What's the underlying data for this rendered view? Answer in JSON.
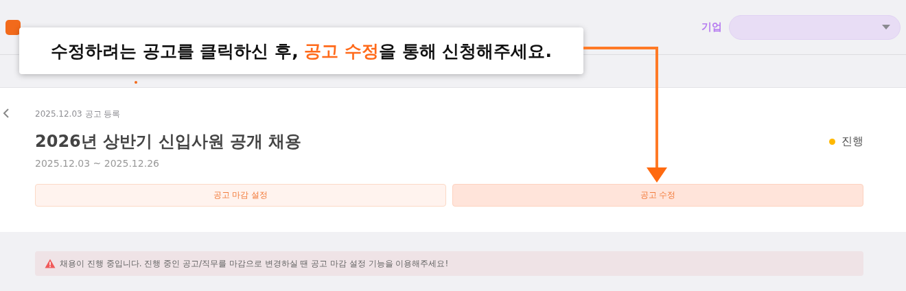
{
  "header": {
    "company_label": "기업"
  },
  "guide": {
    "text": "수정하려는 공고를 클릭하신 후, **공고 수정**을 통해 신청해주세요."
  },
  "posting": {
    "registered": "2025.12.03 공고 등록",
    "title": "2026년 상반기 신입사원 공개 채용",
    "period": "2025.12.03 ~ 2025.12.26",
    "status": {
      "label": "진행",
      "color": "#ffb800"
    },
    "buttons": [
      {
        "label": "공고 마감 설정",
        "selected": false
      },
      {
        "label": "공고 수정",
        "selected": true
      }
    ]
  },
  "alert": {
    "text": "채용이 진행 중입니다. 진행 중인 공고/직무를 마감으로 변경하실 땐 공고 마감 설정 기능을 이용해주세요!"
  }
}
